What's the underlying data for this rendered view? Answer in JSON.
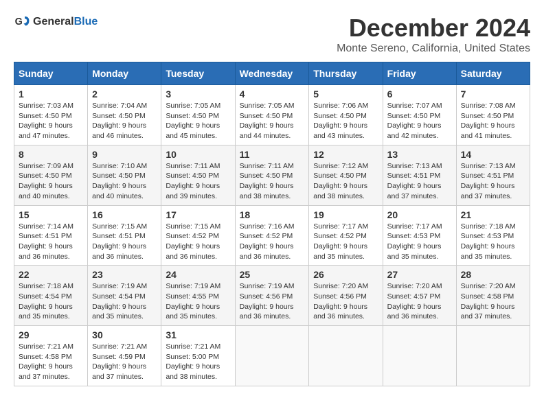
{
  "header": {
    "logo_general": "General",
    "logo_blue": "Blue",
    "title": "December 2024",
    "location": "Monte Sereno, California, United States"
  },
  "days_of_week": [
    "Sunday",
    "Monday",
    "Tuesday",
    "Wednesday",
    "Thursday",
    "Friday",
    "Saturday"
  ],
  "weeks": [
    [
      {
        "day": "1",
        "info": "Sunrise: 7:03 AM\nSunset: 4:50 PM\nDaylight: 9 hours\nand 47 minutes."
      },
      {
        "day": "2",
        "info": "Sunrise: 7:04 AM\nSunset: 4:50 PM\nDaylight: 9 hours\nand 46 minutes."
      },
      {
        "day": "3",
        "info": "Sunrise: 7:05 AM\nSunset: 4:50 PM\nDaylight: 9 hours\nand 45 minutes."
      },
      {
        "day": "4",
        "info": "Sunrise: 7:05 AM\nSunset: 4:50 PM\nDaylight: 9 hours\nand 44 minutes."
      },
      {
        "day": "5",
        "info": "Sunrise: 7:06 AM\nSunset: 4:50 PM\nDaylight: 9 hours\nand 43 minutes."
      },
      {
        "day": "6",
        "info": "Sunrise: 7:07 AM\nSunset: 4:50 PM\nDaylight: 9 hours\nand 42 minutes."
      },
      {
        "day": "7",
        "info": "Sunrise: 7:08 AM\nSunset: 4:50 PM\nDaylight: 9 hours\nand 41 minutes."
      }
    ],
    [
      {
        "day": "8",
        "info": "Sunrise: 7:09 AM\nSunset: 4:50 PM\nDaylight: 9 hours\nand 40 minutes."
      },
      {
        "day": "9",
        "info": "Sunrise: 7:10 AM\nSunset: 4:50 PM\nDaylight: 9 hours\nand 40 minutes."
      },
      {
        "day": "10",
        "info": "Sunrise: 7:11 AM\nSunset: 4:50 PM\nDaylight: 9 hours\nand 39 minutes."
      },
      {
        "day": "11",
        "info": "Sunrise: 7:11 AM\nSunset: 4:50 PM\nDaylight: 9 hours\nand 38 minutes."
      },
      {
        "day": "12",
        "info": "Sunrise: 7:12 AM\nSunset: 4:50 PM\nDaylight: 9 hours\nand 38 minutes."
      },
      {
        "day": "13",
        "info": "Sunrise: 7:13 AM\nSunset: 4:51 PM\nDaylight: 9 hours\nand 37 minutes."
      },
      {
        "day": "14",
        "info": "Sunrise: 7:13 AM\nSunset: 4:51 PM\nDaylight: 9 hours\nand 37 minutes."
      }
    ],
    [
      {
        "day": "15",
        "info": "Sunrise: 7:14 AM\nSunset: 4:51 PM\nDaylight: 9 hours\nand 36 minutes."
      },
      {
        "day": "16",
        "info": "Sunrise: 7:15 AM\nSunset: 4:51 PM\nDaylight: 9 hours\nand 36 minutes."
      },
      {
        "day": "17",
        "info": "Sunrise: 7:15 AM\nSunset: 4:52 PM\nDaylight: 9 hours\nand 36 minutes."
      },
      {
        "day": "18",
        "info": "Sunrise: 7:16 AM\nSunset: 4:52 PM\nDaylight: 9 hours\nand 36 minutes."
      },
      {
        "day": "19",
        "info": "Sunrise: 7:17 AM\nSunset: 4:52 PM\nDaylight: 9 hours\nand 35 minutes."
      },
      {
        "day": "20",
        "info": "Sunrise: 7:17 AM\nSunset: 4:53 PM\nDaylight: 9 hours\nand 35 minutes."
      },
      {
        "day": "21",
        "info": "Sunrise: 7:18 AM\nSunset: 4:53 PM\nDaylight: 9 hours\nand 35 minutes."
      }
    ],
    [
      {
        "day": "22",
        "info": "Sunrise: 7:18 AM\nSunset: 4:54 PM\nDaylight: 9 hours\nand 35 minutes."
      },
      {
        "day": "23",
        "info": "Sunrise: 7:19 AM\nSunset: 4:54 PM\nDaylight: 9 hours\nand 35 minutes."
      },
      {
        "day": "24",
        "info": "Sunrise: 7:19 AM\nSunset: 4:55 PM\nDaylight: 9 hours\nand 35 minutes."
      },
      {
        "day": "25",
        "info": "Sunrise: 7:19 AM\nSunset: 4:56 PM\nDaylight: 9 hours\nand 36 minutes."
      },
      {
        "day": "26",
        "info": "Sunrise: 7:20 AM\nSunset: 4:56 PM\nDaylight: 9 hours\nand 36 minutes."
      },
      {
        "day": "27",
        "info": "Sunrise: 7:20 AM\nSunset: 4:57 PM\nDaylight: 9 hours\nand 36 minutes."
      },
      {
        "day": "28",
        "info": "Sunrise: 7:20 AM\nSunset: 4:58 PM\nDaylight: 9 hours\nand 37 minutes."
      }
    ],
    [
      {
        "day": "29",
        "info": "Sunrise: 7:21 AM\nSunset: 4:58 PM\nDaylight: 9 hours\nand 37 minutes."
      },
      {
        "day": "30",
        "info": "Sunrise: 7:21 AM\nSunset: 4:59 PM\nDaylight: 9 hours\nand 37 minutes."
      },
      {
        "day": "31",
        "info": "Sunrise: 7:21 AM\nSunset: 5:00 PM\nDaylight: 9 hours\nand 38 minutes."
      },
      {
        "day": "",
        "info": ""
      },
      {
        "day": "",
        "info": ""
      },
      {
        "day": "",
        "info": ""
      },
      {
        "day": "",
        "info": ""
      }
    ]
  ]
}
